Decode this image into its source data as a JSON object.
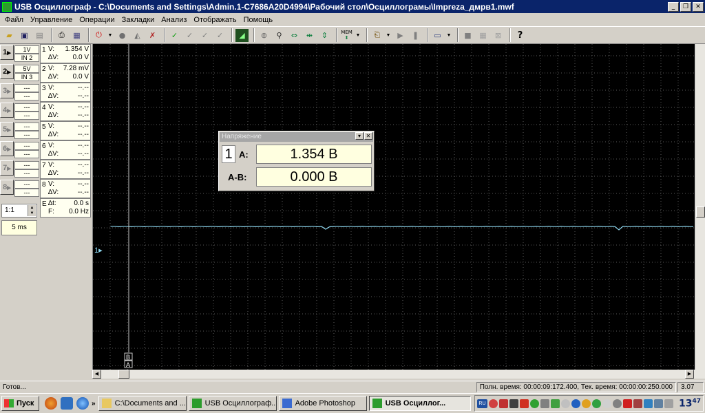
{
  "window": {
    "title": "USB Осциллограф - C:\\Documents and Settings\\Admin.1-C7686A20D4994\\Рабочий стол\\Осциллограмы\\Impreza_дмрв1.mwf",
    "minimize": "_",
    "maximize": "❐",
    "close": "✕"
  },
  "menu": [
    "Файл",
    "Управление",
    "Операции",
    "Закладки",
    "Анализ",
    "Отображать",
    "Помощь"
  ],
  "toolbar": {
    "mem_label": "MEM",
    "help": "?"
  },
  "channels": [
    {
      "num": "1",
      "scale": "1V",
      "input": "IN 2",
      "v": "1.354 V",
      "dv": "0.0 V",
      "active": true
    },
    {
      "num": "2",
      "scale": "5V",
      "input": "IN 3",
      "v": "7.28 mV",
      "dv": "0.0 V",
      "active": true
    },
    {
      "num": "3",
      "scale": "---",
      "input": "---",
      "v": "--.--",
      "dv": "--.--",
      "active": false
    },
    {
      "num": "4",
      "scale": "---",
      "input": "---",
      "v": "--.--",
      "dv": "--.--",
      "active": false
    },
    {
      "num": "5",
      "scale": "---",
      "input": "---",
      "v": "--.--",
      "dv": "--.--",
      "active": false
    },
    {
      "num": "6",
      "scale": "---",
      "input": "---",
      "v": "--.--",
      "dv": "--.--",
      "active": false
    },
    {
      "num": "7",
      "scale": "---",
      "input": "---",
      "v": "--.--",
      "dv": "--.--",
      "active": false
    },
    {
      "num": "8",
      "scale": "---",
      "input": "---",
      "v": "--.--",
      "dv": "--.--",
      "active": false
    }
  ],
  "row_labels": {
    "v": "V:",
    "dv": "∆V:"
  },
  "cursor_info": {
    "num": "E",
    "dt_label": "∆t:",
    "dt": "0.0 s",
    "f_label": "F:",
    "f": "0.0 Hz"
  },
  "ratio": "1:1",
  "timebase": "5 ms",
  "scope": {
    "marker_label": "1▸",
    "cursor_b": "B",
    "cursor_a": "A",
    "trace_color": "#8ed8f0",
    "grid_color": "#5a5a5a",
    "cursor_color": "#c8c8c8"
  },
  "voltage_dialog": {
    "title": "Напряжение",
    "channel": "1",
    "a_label": "A:",
    "a_value": "1.354 В",
    "ab_label": "A-B:",
    "ab_value": "0.000 В"
  },
  "status": {
    "ready": "Готов...",
    "times": "Полн. время: 00:00:09:172.400, Тек. время: 00:00:00:250.000",
    "version": "3.07"
  },
  "taskbar": {
    "start": "Пуск",
    "more": "»",
    "tasks": [
      {
        "label": "C:\\Documents and ...",
        "icon_color": "#e8c860",
        "active": false
      },
      {
        "label": "USB Осциллограф...",
        "icon_color": "#2c9c2c",
        "active": false
      },
      {
        "label": "Adobe Photoshop",
        "icon_color": "#3a6ad0",
        "active": false
      },
      {
        "label": "USB Осциллог...",
        "icon_color": "#2c9c2c",
        "active": true
      }
    ],
    "tray_lang": "RU",
    "clock_hour": "13",
    "clock_min": "47"
  }
}
